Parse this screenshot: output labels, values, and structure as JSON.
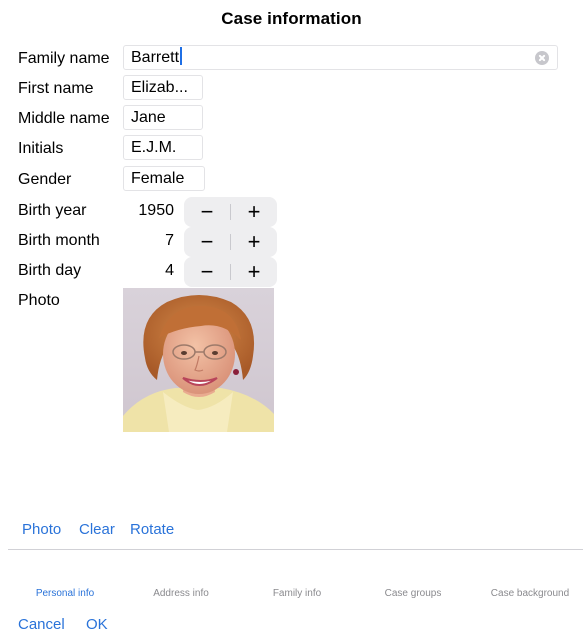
{
  "header": {
    "title": "Case information"
  },
  "fields": {
    "family_name": {
      "label": "Family name",
      "value": "Barrett"
    },
    "first_name": {
      "label": "First name",
      "value": "Elizab..."
    },
    "middle_name": {
      "label": "Middle name",
      "value": "Jane"
    },
    "initials": {
      "label": "Initials",
      "value": "E.J.M."
    },
    "gender": {
      "label": "Gender",
      "value": "Female"
    },
    "birth_year": {
      "label": "Birth year",
      "value": "1950"
    },
    "birth_month": {
      "label": "Birth month",
      "value": "7"
    },
    "birth_day": {
      "label": "Birth day",
      "value": "4"
    },
    "photo": {
      "label": "Photo"
    }
  },
  "stepper": {
    "minus": "−",
    "plus": "+"
  },
  "photo_actions": {
    "photo": "Photo",
    "clear": "Clear",
    "rotate": "Rotate"
  },
  "tabs": [
    {
      "label": "Personal info",
      "active": true
    },
    {
      "label": "Address info",
      "active": false
    },
    {
      "label": "Family info",
      "active": false
    },
    {
      "label": "Case groups",
      "active": false
    },
    {
      "label": "Case background",
      "active": false
    }
  ],
  "footer": {
    "cancel": "Cancel",
    "ok": "OK"
  },
  "colors": {
    "accent": "#2a73d9",
    "divider": "#d1d1d6",
    "stepper_bg": "#eeeef0"
  },
  "icons": {
    "clear_field": "clear-circle-icon"
  }
}
